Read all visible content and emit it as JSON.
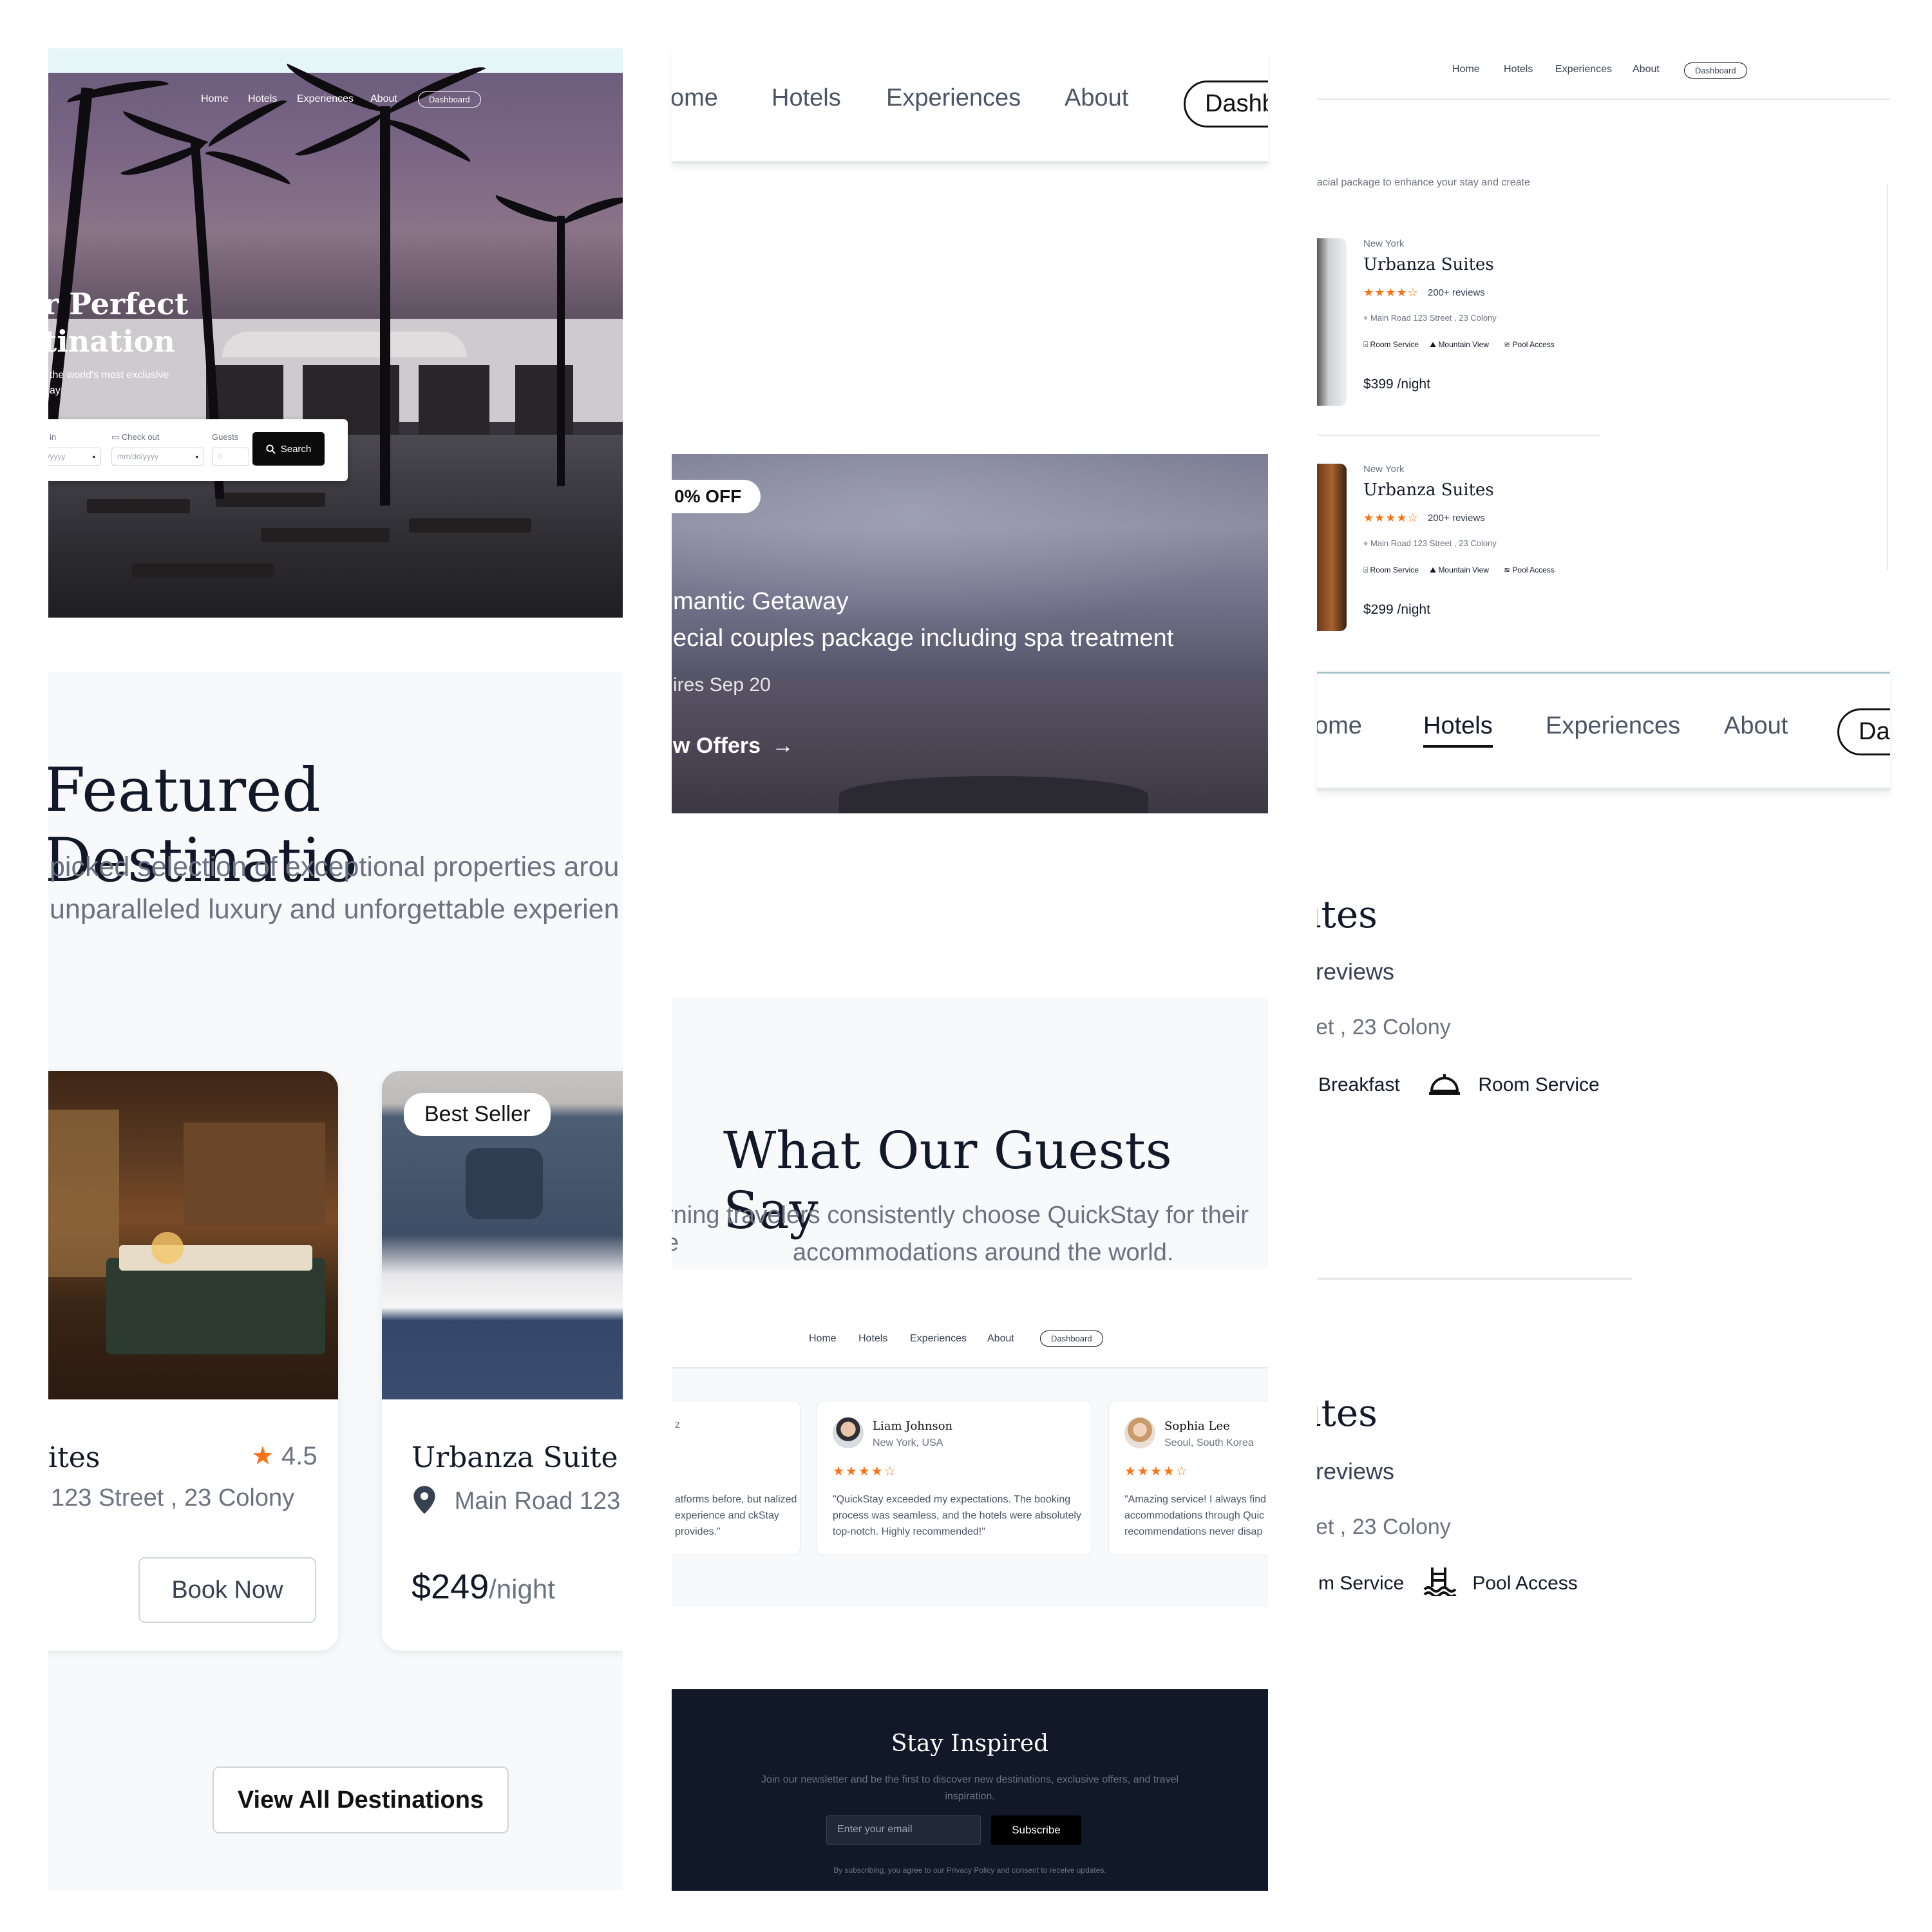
{
  "nav": {
    "home": "Home",
    "home_cut": "ome",
    "hotels": "Hotels",
    "experiences": "Experiences",
    "about": "About",
    "dashboard": "Dashboard",
    "dashboard_cut_a": "Dashbo",
    "dashboard_cut_b": "Dash"
  },
  "hero": {
    "title_line1": "r Perfect",
    "title_line2": "tination",
    "subtitle_line1": "the world's most exclusive",
    "subtitle_line2": "ay",
    "checkin_label": "in",
    "checkin_value": "/yyyy",
    "checkout_label": "Check out",
    "checkout_value": "mm/dd/yyyy",
    "guests_label": "Guests",
    "guests_value": "0",
    "search_label": "Search"
  },
  "featured": {
    "title": "Featured Destinatio",
    "subtitle_line1": "picked selection of exceptional properties arou",
    "subtitle_line2": "unparalleled luxury and unforgettable experien",
    "card1": {
      "name": "ites",
      "rating": "4.5",
      "address": "123 Street , 23 Colony",
      "cta": "Book Now"
    },
    "card2": {
      "badge": "Best Seller",
      "name": "Urbanza Suite",
      "address": "Main Road 123",
      "price": "$249",
      "per": "/night"
    },
    "view_all": "View All Destinations"
  },
  "offer": {
    "discount": "0% OFF",
    "title": "mantic Getaway",
    "description": "ecial couples package including spa treatment",
    "expiry": "ires Sep 20",
    "cta": "w Offers"
  },
  "testimonials": {
    "title": "What Our Guests Say",
    "subtitle_line1": "rning travelers consistently choose QuickStay for their e",
    "subtitle_line2": "accommodations around the world.",
    "cards": [
      {
        "name": "",
        "location": "z",
        "quote": "atforms before, but nalized experience and ckStay provides.\""
      },
      {
        "name": "Liam Johnson",
        "location": "New York, USA",
        "stars": "★★★★☆",
        "quote": "\"QuickStay exceeded my expectations. The booking process was seamless, and the hotels were absolutely top-notch. Highly recommended!\""
      },
      {
        "name": "Sophia Lee",
        "location": "Seoul, South Korea",
        "stars": "★★★★☆",
        "quote": "\"Amazing service! I always find accommodations through Quic recommendations never disap"
      }
    ]
  },
  "newsletter": {
    "title": "Stay Inspired",
    "subtitle_line1": "Join our newsletter and be the first to discover new destinations, exclusive offers, and travel",
    "subtitle_line2": "inspiration.",
    "email_placeholder": "Enter your email",
    "subscribe": "Subscribe",
    "fine_print": "By subscribing, you agree to our Privacy Policy and consent to receive updates."
  },
  "hotels": {
    "intro": "acial package to enhance your stay and create",
    "list": [
      {
        "city": "New York",
        "name": "Urbanza Suites",
        "stars": "★★★★☆",
        "reviews": "200+ reviews",
        "address": "Main Road 123 Street , 23 Colony",
        "amenities": [
          "Room Service",
          "Mountain View",
          "Pool Access"
        ],
        "price": "$399 /night"
      },
      {
        "city": "New York",
        "name": "Urbanza Suites",
        "stars": "★★★★☆",
        "reviews": "200+ reviews",
        "address": "Main Road 123 Street , 23 Colony",
        "amenities": [
          "Room Service",
          "Mountain View",
          "Pool Access"
        ],
        "price": "$299 /night"
      }
    ]
  },
  "zoom_detail": {
    "name": "ites",
    "reviews": "reviews",
    "address": "et , 23 Colony",
    "amenity_a1": "Breakfast",
    "amenity_a2": "Room Service",
    "amenity_b1": "m Service",
    "amenity_b2": "Pool Access"
  },
  "colors": {
    "accent_star": "#f97316",
    "dark_footer": "#111827",
    "text_primary": "#111827",
    "text_muted": "#6b7280"
  }
}
